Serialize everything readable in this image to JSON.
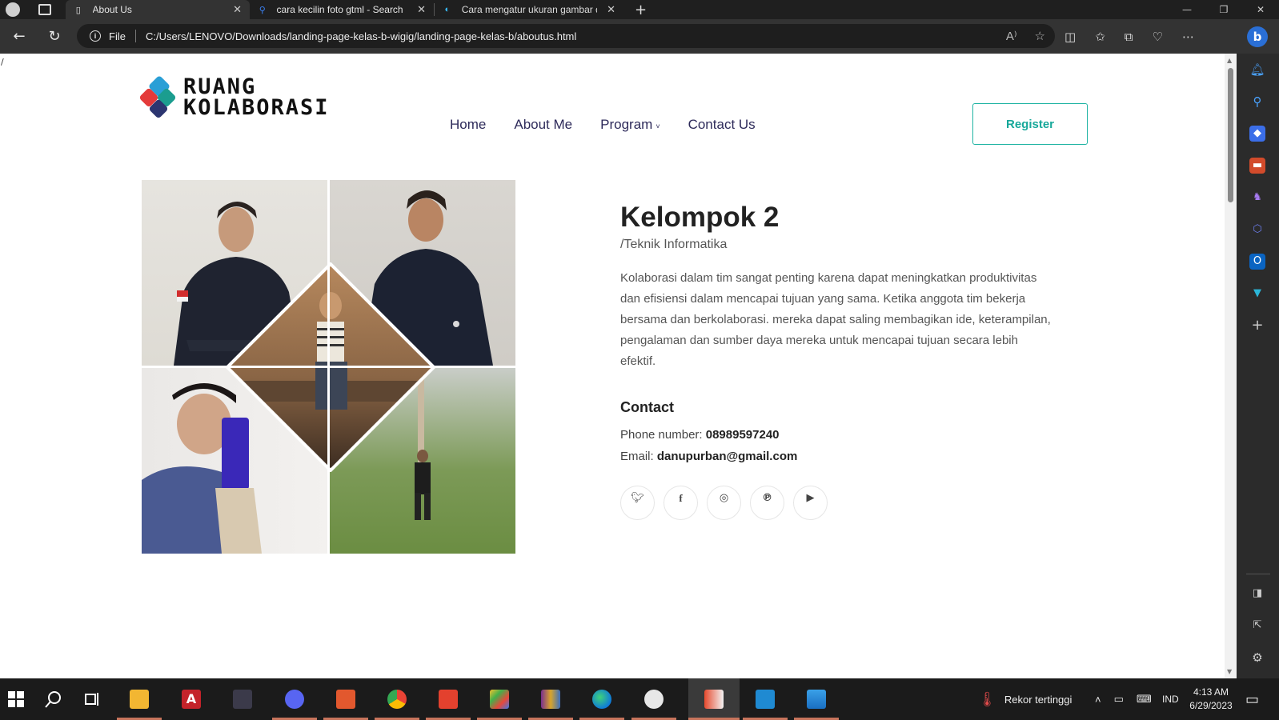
{
  "browser": {
    "tabs": [
      {
        "title": "About Us",
        "icon": "page-icon",
        "active": true
      },
      {
        "title": "cara kecilin foto gtml - Search",
        "icon": "search-icon",
        "active": false
      },
      {
        "title": "Cara mengatur ukuran gambar d",
        "icon": "edge-icon",
        "active": false
      }
    ],
    "address": {
      "scheme_label": "File",
      "url": "C:/Users/LENOVO/Downloads/landing-page-kelas-b-wigig/landing-page-kelas-b/aboutus.html"
    }
  },
  "page": {
    "stray_text": "/",
    "logo": {
      "line1": "RUANG",
      "line2": "KOLABORASI"
    },
    "nav": [
      {
        "label": "Home"
      },
      {
        "label": "About Me"
      },
      {
        "label": "Program",
        "dropdown": true
      },
      {
        "label": "Contact Us"
      }
    ],
    "register_label": "Register",
    "profile": {
      "name": "Kelompok 2",
      "subtitle": "/Teknik Informatika",
      "description": "Kolaborasi dalam tim sangat penting karena dapat meningkatkan produktivitas dan efisiensi dalam mencapai tujuan yang sama. Ketika anggota tim bekerja bersama dan berkolaborasi. mereka dapat saling membagikan ide, keterampilan, pengalaman dan sumber daya mereka untuk mencapai tujuan secara lebih efektif.",
      "contact_heading": "Contact",
      "phone_label": "Phone number: ",
      "phone": "08989597240",
      "email_label": "Email: ",
      "email": "danupurban@gmail.com",
      "social": [
        "twitter-icon",
        "facebook-icon",
        "instagram-icon",
        "pinterest-icon",
        "youtube-icon"
      ]
    }
  },
  "taskbar": {
    "weather_text": "Rekor tertinggi",
    "language": "IND",
    "time": "4:13 AM",
    "date": "6/29/2023"
  }
}
